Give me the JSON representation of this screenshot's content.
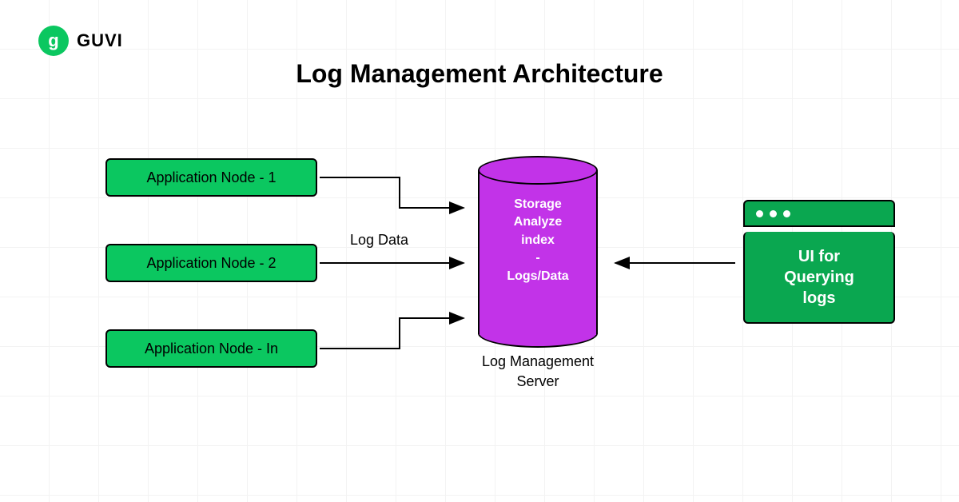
{
  "brand": {
    "logo_glyph": "g",
    "name": "GUVI",
    "brand_color": "#0bc760"
  },
  "title": "Log Management Architecture",
  "app_nodes": [
    "Application Node - 1",
    "Application Node - 2",
    "Application Node - In"
  ],
  "flow_label": "Log Data",
  "cylinder": {
    "line1": "Storage",
    "line2": "Analyze",
    "line3": "index",
    "line4": "-",
    "line5": "Logs/Data"
  },
  "server_label": "Log Management Server",
  "ui_box": {
    "line1": "UI for",
    "line2": "Querying",
    "line3": "logs"
  },
  "colors": {
    "green": "#0bc760",
    "dark_green": "#0aa750",
    "purple": "#c233e8",
    "black": "#000000"
  }
}
